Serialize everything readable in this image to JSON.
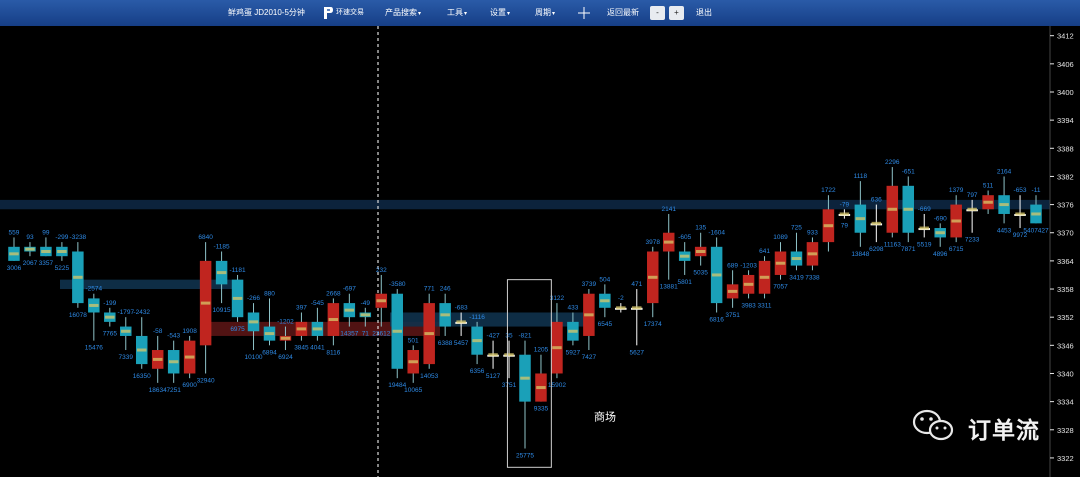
{
  "topbar": {
    "title": "鲜鸡蛋 JD2010-5分钟",
    "logo_text": "环速交易",
    "menu_product": "产品搜索",
    "menu_tools": "工具",
    "menu_settings": "设置",
    "menu_period": "周期",
    "crosshair_icon": "crosshair-icon",
    "menu_restore": "返回最新",
    "btn_minus": "-",
    "btn_plus": "+",
    "menu_exit": "退出"
  },
  "colors": {
    "up": "#c0251f",
    "down": "#1aa0b8",
    "doji": "#ffffff",
    "label": "#2e8ae6",
    "axis": "#e6e6e6",
    "band": "#0f2a44",
    "topbar": "#1f4d9a"
  },
  "chart_data": {
    "type": "candlestick",
    "y_axis_ticks": [
      3412,
      3406,
      3400,
      3394,
      3388,
      3382,
      3376,
      3370,
      3364,
      3358,
      3352,
      3346,
      3340,
      3334,
      3328,
      3322
    ],
    "ylim": [
      3319,
      3413
    ],
    "annotation": "商场",
    "candles": [
      {
        "o": 3367,
        "h": 3369,
        "l": 3364,
        "c": 3364,
        "d": "559",
        "v": "3006"
      },
      {
        "o": 3367,
        "h": 3368,
        "l": 3365,
        "c": 3366,
        "d": "93",
        "v": "2067"
      },
      {
        "o": 3367,
        "h": 3369,
        "l": 3365,
        "c": 3365,
        "d": "99",
        "v": "3357"
      },
      {
        "o": 3367,
        "h": 3368,
        "l": 3364,
        "c": 3365,
        "d": "-299",
        "v": "5225"
      },
      {
        "o": 3366,
        "h": 3368,
        "l": 3354,
        "c": 3355,
        "d": "-3238",
        "v": "16078"
      },
      {
        "o": 3356,
        "h": 3357,
        "l": 3347,
        "c": 3353,
        "d": "-2574",
        "v": "15476"
      },
      {
        "o": 3353,
        "h": 3354,
        "l": 3350,
        "c": 3351,
        "d": "-199",
        "v": "7765"
      },
      {
        "o": 3350,
        "h": 3352,
        "l": 3345,
        "c": 3348,
        "d": "-1797",
        "v": "7339"
      },
      {
        "o": 3348,
        "h": 3352,
        "l": 3341,
        "c": 3342,
        "d": "-2432",
        "v": "16350"
      },
      {
        "o": 3341,
        "h": 3348,
        "l": 3338,
        "c": 3345,
        "d": "-58",
        "v": "18634"
      },
      {
        "o": 3345,
        "h": 3347,
        "l": 3338,
        "c": 3340,
        "d": "-543",
        "v": "7251"
      },
      {
        "o": 3340,
        "h": 3348,
        "l": 3339,
        "c": 3347,
        "d": "1908",
        "v": "6900"
      },
      {
        "o": 3346,
        "h": 3368,
        "l": 3340,
        "c": 3364,
        "d": "6840",
        "v": "32940"
      },
      {
        "o": 3364,
        "h": 3366,
        "l": 3355,
        "c": 3359,
        "d": "-1185",
        "v": "10915"
      },
      {
        "o": 3360,
        "h": 3361,
        "l": 3351,
        "c": 3352,
        "d": "-1181",
        "v": "6975"
      },
      {
        "o": 3353,
        "h": 3355,
        "l": 3345,
        "c": 3349,
        "d": "-266",
        "v": "10100"
      },
      {
        "o": 3350,
        "h": 3356,
        "l": 3346,
        "c": 3347,
        "d": "880",
        "v": "6894"
      },
      {
        "o": 3347,
        "h": 3350,
        "l": 3345,
        "c": 3348,
        "d": "-1202",
        "v": "6924"
      },
      {
        "o": 3348,
        "h": 3353,
        "l": 3347,
        "c": 3351,
        "d": "397",
        "v": "3845"
      },
      {
        "o": 3351,
        "h": 3354,
        "l": 3347,
        "c": 3348,
        "d": "-545",
        "v": "4041"
      },
      {
        "o": 3348,
        "h": 3356,
        "l": 3346,
        "c": 3355,
        "d": "2668",
        "v": "8116"
      },
      {
        "o": 3355,
        "h": 3357,
        "l": 3350,
        "c": 3352,
        "d": "-697",
        "v": "14357"
      },
      {
        "o": 3353,
        "h": 3354,
        "l": 3350,
        "c": 3352,
        "d": "-49",
        "v": "71"
      },
      {
        "o": 3354,
        "h": 3361,
        "l": 3350,
        "c": 3357,
        "d": "232",
        "v": "23612"
      },
      {
        "o": 3357,
        "h": 3358,
        "l": 3339,
        "c": 3341,
        "d": "-3580",
        "v": "19484"
      },
      {
        "o": 3340,
        "h": 3346,
        "l": 3338,
        "c": 3345,
        "d": "501",
        "v": "10065"
      },
      {
        "o": 3342,
        "h": 3357,
        "l": 3341,
        "c": 3355,
        "d": "771",
        "v": "14053"
      },
      {
        "o": 3355,
        "h": 3357,
        "l": 3348,
        "c": 3350,
        "d": "246",
        "v": "6388"
      },
      {
        "o": 3351,
        "h": 3353,
        "l": 3348,
        "c": 3351,
        "d": "-683",
        "v": "5457"
      },
      {
        "o": 3350,
        "h": 3351,
        "l": 3342,
        "c": 3344,
        "d": "-1116",
        "v": "6356"
      },
      {
        "o": 3344,
        "h": 3347,
        "l": 3341,
        "c": 3344,
        "d": "-427",
        "v": "5127"
      },
      {
        "o": 3344,
        "h": 3347,
        "l": 3339,
        "c": 3344,
        "d": "35",
        "v": "3751"
      },
      {
        "o": 3344,
        "h": 3347,
        "l": 3324,
        "c": 3334,
        "d": "-821",
        "v": "25775"
      },
      {
        "o": 3334,
        "h": 3344,
        "l": 3334,
        "c": 3340,
        "d": "1205",
        "v": "9335"
      },
      {
        "o": 3340,
        "h": 3355,
        "l": 3339,
        "c": 3351,
        "d": "3122",
        "v": "15902"
      },
      {
        "o": 3351,
        "h": 3353,
        "l": 3346,
        "c": 3347,
        "d": "433",
        "v": "5927"
      },
      {
        "o": 3348,
        "h": 3358,
        "l": 3345,
        "c": 3357,
        "d": "3739",
        "v": "7427"
      },
      {
        "o": 3357,
        "h": 3359,
        "l": 3352,
        "c": 3354,
        "d": "504",
        "v": "6545"
      },
      {
        "o": 3354,
        "h": 3355,
        "l": 3353,
        "c": 3354,
        "d": "-2",
        "v": ""
      },
      {
        "o": 3354,
        "h": 3358,
        "l": 3346,
        "c": 3354,
        "d": "471",
        "v": "5627"
      },
      {
        "o": 3355,
        "h": 3367,
        "l": 3352,
        "c": 3366,
        "d": "3978",
        "v": "17374"
      },
      {
        "o": 3366,
        "h": 3374,
        "l": 3360,
        "c": 3370,
        "d": "2141",
        "v": "13881"
      },
      {
        "o": 3366,
        "h": 3368,
        "l": 3361,
        "c": 3364,
        "d": "-605",
        "v": "5801"
      },
      {
        "o": 3365,
        "h": 3370,
        "l": 3363,
        "c": 3367,
        "d": "135",
        "v": "5035"
      },
      {
        "o": 3367,
        "h": 3369,
        "l": 3353,
        "c": 3355,
        "d": "-1604",
        "v": "6816"
      },
      {
        "o": 3356,
        "h": 3362,
        "l": 3354,
        "c": 3359,
        "d": "689",
        "v": "3751"
      },
      {
        "o": 3357,
        "h": 3362,
        "l": 3356,
        "c": 3361,
        "d": "-1203",
        "v": "3983"
      },
      {
        "o": 3357,
        "h": 3365,
        "l": 3356,
        "c": 3364,
        "d": "641",
        "v": "3311"
      },
      {
        "o": 3361,
        "h": 3368,
        "l": 3360,
        "c": 3366,
        "d": "1089",
        "v": "7057"
      },
      {
        "o": 3366,
        "h": 3370,
        "l": 3362,
        "c": 3363,
        "d": "725",
        "v": "3419"
      },
      {
        "o": 3363,
        "h": 3369,
        "l": 3362,
        "c": 3368,
        "d": "933",
        "v": "7338"
      },
      {
        "o": 3368,
        "h": 3378,
        "l": 3366,
        "c": 3375,
        "d": "1722",
        "v": ""
      },
      {
        "o": 3374,
        "h": 3375,
        "l": 3373,
        "c": 3374,
        "d": "-79",
        "v": "79"
      },
      {
        "o": 3376,
        "h": 3381,
        "l": 3367,
        "c": 3370,
        "d": "1118",
        "v": "13848"
      },
      {
        "o": 3372,
        "h": 3376,
        "l": 3368,
        "c": 3372,
        "d": "636",
        "v": "6298"
      },
      {
        "o": 3370,
        "h": 3384,
        "l": 3369,
        "c": 3380,
        "d": "2296",
        "v": "11163"
      },
      {
        "o": 3380,
        "h": 3382,
        "l": 3368,
        "c": 3370,
        "d": "-651",
        "v": "7871"
      },
      {
        "o": 3371,
        "h": 3374,
        "l": 3369,
        "c": 3371,
        "d": "-669",
        "v": "5519"
      },
      {
        "o": 3371,
        "h": 3372,
        "l": 3367,
        "c": 3369,
        "d": "-690",
        "v": "4896"
      },
      {
        "o": 3369,
        "h": 3378,
        "l": 3368,
        "c": 3376,
        "d": "1379",
        "v": "6715"
      },
      {
        "o": 3375,
        "h": 3377,
        "l": 3370,
        "c": 3375,
        "d": "797",
        "v": "7233"
      },
      {
        "o": 3375,
        "h": 3379,
        "l": 3374,
        "c": 3378,
        "d": "511",
        "v": ""
      },
      {
        "o": 3378,
        "h": 3382,
        "l": 3372,
        "c": 3374,
        "d": "2164",
        "v": "4453"
      },
      {
        "o": 3374,
        "h": 3378,
        "l": 3371,
        "c": 3374,
        "d": "-653",
        "v": "9972"
      },
      {
        "o": 3376,
        "h": 3378,
        "l": 3372,
        "c": 3372,
        "d": "-11",
        "v": "5407427"
      }
    ]
  }
}
